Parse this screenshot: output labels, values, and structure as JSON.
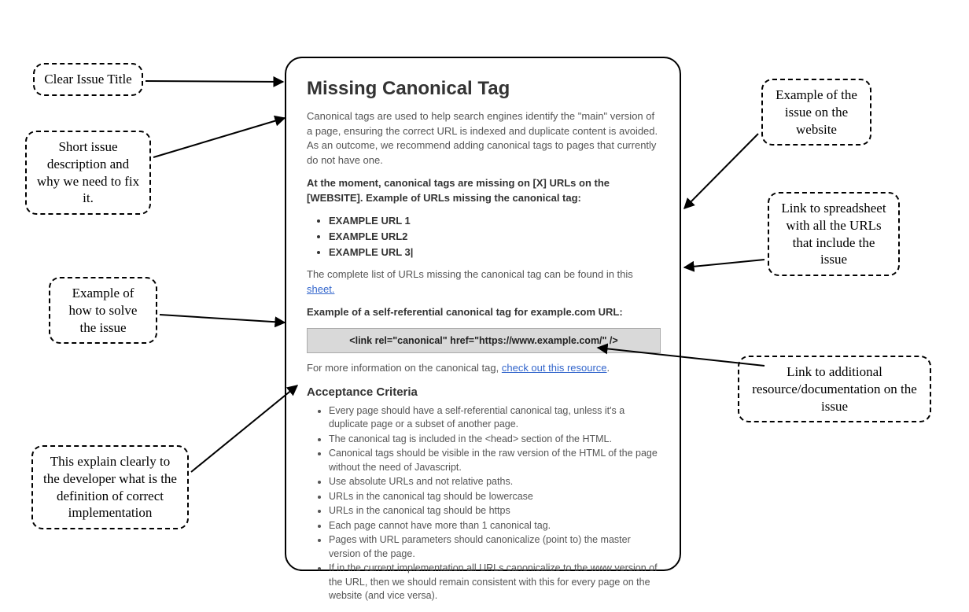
{
  "document": {
    "title": "Missing Canonical Tag",
    "intro": "Canonical tags are used to help search engines identify the \"main\" version of a page, ensuring the correct URL is indexed and duplicate content is avoided. As an outcome, we recommend adding canonical tags to pages that currently do not have one.",
    "status_line": "At the moment, canonical tags are missing on [X] URLs on the [WEBSITE]. Example of URLs missing the canonical tag:",
    "example_urls": [
      "EXAMPLE URL 1",
      "EXAMPLE URL2",
      "EXAMPLE URL 3|"
    ],
    "complete_list_text_pre": "The complete list of URLs missing the canonical tag can be found in this ",
    "complete_list_link": "sheet.",
    "self_ref_heading": "Example of a self-referential canonical tag for example.com URL:",
    "code_sample": "<link rel=\"canonical\" href=\"https://www.example.com/\" />",
    "more_info_pre": "For more information on the canonical tag, ",
    "more_info_link": "check out this resource",
    "more_info_post": ".",
    "acceptance_heading": "Acceptance Criteria",
    "acceptance_items": [
      "Every page should have a self-referential canonical tag, unless it's a duplicate page or a subset of another page.",
      "The canonical tag is included in the <head> section of the HTML.",
      "Canonical tags should be visible in the raw version of the HTML of the page without the need of Javascript.",
      "Use absolute URLs and not relative paths.",
      "URLs in the canonical tag should be lowercase",
      "URLs in the canonical tag should be https",
      "Each page cannot have more than 1 canonical tag.",
      "Pages with URL parameters should canonicalize (point to) the master version of the page.",
      "If in the current implementation all URLs canonicalize to the www version of the URL, then we should remain consistent with this for every page on the website (and vice versa)."
    ]
  },
  "annotations": {
    "clear_title": "Clear Issue Title",
    "short_desc": "Short issue description and why we need to fix it.",
    "example_solve": "Example of how to solve the issue",
    "explain_dev": "This explain clearly to the developer what is the definition of correct implementation",
    "example_issue": "Example of the issue on the website",
    "link_sheet": "Link to spreadsheet with all the URLs that include the issue",
    "link_resource": "Link to additional resource/documentation on the issue"
  }
}
